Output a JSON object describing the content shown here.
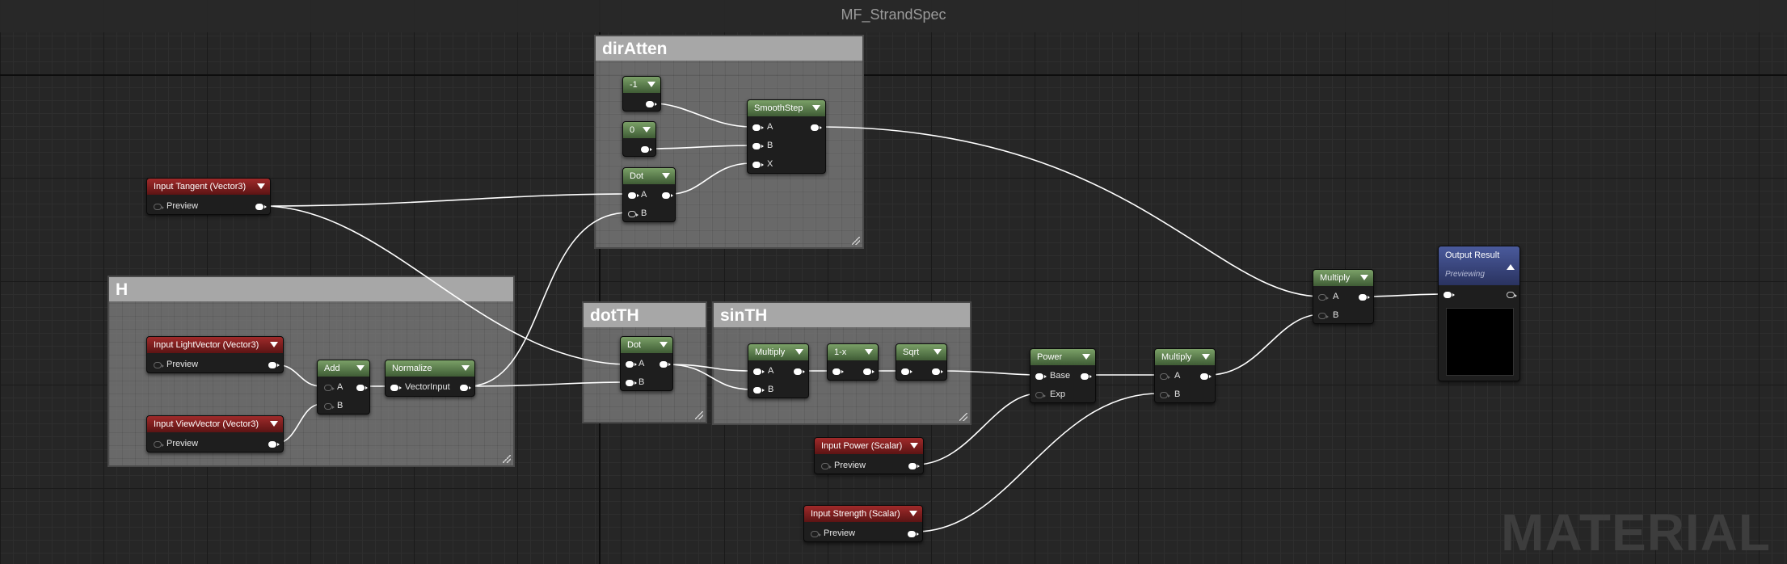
{
  "window": {
    "title": "MF_StrandSpec",
    "watermark": "MATERIAL"
  },
  "comments": {
    "dirAtten": "dirAtten",
    "H": "H",
    "dotTH": "dotTH",
    "sinTH": "sinTH"
  },
  "nodes": {
    "const_neg1": {
      "title": "-1"
    },
    "const_0": {
      "title": "0"
    },
    "dot1": {
      "title": "Dot",
      "pin_a": "A",
      "pin_b": "B"
    },
    "smoothstep": {
      "title": "SmoothStep",
      "pin_a": "A",
      "pin_b": "B",
      "pin_x": "X"
    },
    "input_tangent": {
      "title": "Input Tangent (Vector3)",
      "preview": "Preview"
    },
    "input_light": {
      "title": "Input LightVector (Vector3)",
      "preview": "Preview"
    },
    "input_view": {
      "title": "Input ViewVector (Vector3)",
      "preview": "Preview"
    },
    "add": {
      "title": "Add",
      "pin_a": "A",
      "pin_b": "B"
    },
    "normalize": {
      "title": "Normalize",
      "pin_in": "VectorInput"
    },
    "dot2": {
      "title": "Dot",
      "pin_a": "A",
      "pin_b": "B"
    },
    "multiply1": {
      "title": "Multiply",
      "pin_a": "A",
      "pin_b": "B"
    },
    "one_minus": {
      "title": "1-x"
    },
    "sqrt": {
      "title": "Sqrt"
    },
    "power": {
      "title": "Power",
      "pin_base": "Base",
      "pin_exp": "Exp"
    },
    "multiply2": {
      "title": "Multiply",
      "pin_a": "A",
      "pin_b": "B"
    },
    "multiply3": {
      "title": "Multiply",
      "pin_a": "A",
      "pin_b": "B"
    },
    "input_power": {
      "title": "Input Power (Scalar)",
      "preview": "Preview"
    },
    "input_strength": {
      "title": "Input Strength (Scalar)",
      "preview": "Preview"
    },
    "output": {
      "title": "Output Result",
      "subtitle": "Previewing"
    }
  },
  "colors": {
    "input_header": "#8a2020",
    "function_header": "#5a7d4d",
    "output_header": "#3c4a86",
    "wire": "#ffffff"
  }
}
